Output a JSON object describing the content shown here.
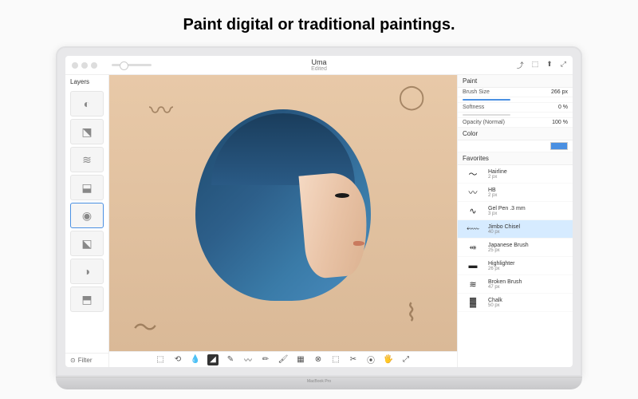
{
  "headline": "Paint digital or traditional paintings.",
  "device_label": "MacBook Pro",
  "document": {
    "name": "Uma",
    "status": "Edited"
  },
  "layers": {
    "header": "Layers",
    "filter_label": "Filter",
    "count": 8
  },
  "paint_panel": {
    "header": "Paint",
    "brush_size": {
      "label": "Brush Size",
      "value": "266 px"
    },
    "softness": {
      "label": "Softness",
      "value": "0 %"
    },
    "opacity": {
      "label": "Opacity (Normal)",
      "value": "100 %"
    }
  },
  "color_panel": {
    "header": "Color",
    "swatch": "#4a90e2"
  },
  "favorites": {
    "header": "Favorites",
    "brushes": [
      {
        "name": "Hairline",
        "size": "2 px",
        "glyph": "〜"
      },
      {
        "name": "HB",
        "size": "2 px",
        "glyph": "〰"
      },
      {
        "name": "Gel Pen .3 mm",
        "size": "3 px",
        "glyph": "∿"
      },
      {
        "name": "Jimbo Chisel",
        "size": "40 px",
        "glyph": "⬳",
        "selected": true
      },
      {
        "name": "Japanese Brush",
        "size": "25 px",
        "glyph": "⬵"
      },
      {
        "name": "Highlighter",
        "size": "26 px",
        "glyph": "▬"
      },
      {
        "name": "Broken Brush",
        "size": "47 px",
        "glyph": "≋"
      },
      {
        "name": "Chalk",
        "size": "50 px",
        "glyph": "▓"
      }
    ]
  },
  "toolbar_tools": [
    "⬚",
    "⟲",
    "💧",
    "◢",
    "✎",
    "〰",
    "✏",
    "🖌",
    "▦",
    "⊗",
    "⬚",
    "✂",
    "⦿",
    "🖐",
    "⤢"
  ],
  "titlebar_icons": [
    "⤴",
    "⬚",
    "⬆",
    "⤢"
  ]
}
